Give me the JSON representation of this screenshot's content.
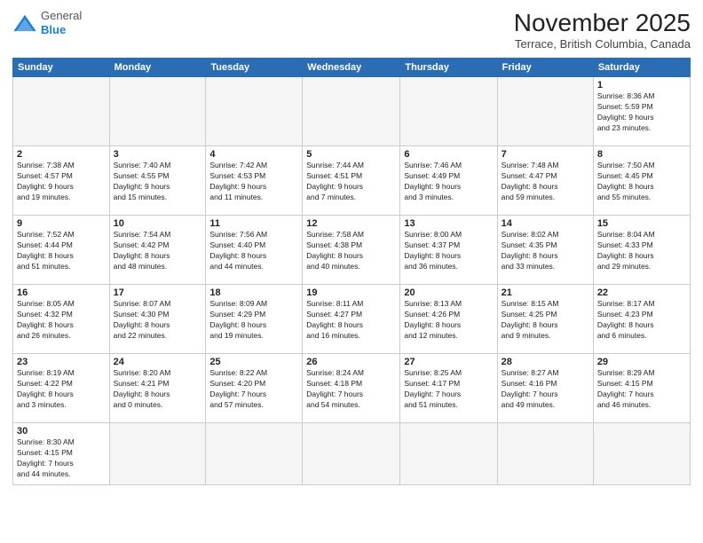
{
  "header": {
    "logo_general": "General",
    "logo_blue": "Blue",
    "month_title": "November 2025",
    "location": "Terrace, British Columbia, Canada"
  },
  "days_of_week": [
    "Sunday",
    "Monday",
    "Tuesday",
    "Wednesday",
    "Thursday",
    "Friday",
    "Saturday"
  ],
  "weeks": [
    [
      {
        "day": "",
        "empty": true
      },
      {
        "day": "",
        "empty": true
      },
      {
        "day": "",
        "empty": true
      },
      {
        "day": "",
        "empty": true
      },
      {
        "day": "",
        "empty": true
      },
      {
        "day": "",
        "empty": true
      },
      {
        "day": "1",
        "info": "Sunrise: 8:36 AM\nSunset: 5:59 PM\nDaylight: 9 hours\nand 23 minutes."
      }
    ],
    [
      {
        "day": "2",
        "info": "Sunrise: 7:38 AM\nSunset: 4:57 PM\nDaylight: 9 hours\nand 19 minutes."
      },
      {
        "day": "3",
        "info": "Sunrise: 7:40 AM\nSunset: 4:55 PM\nDaylight: 9 hours\nand 15 minutes."
      },
      {
        "day": "4",
        "info": "Sunrise: 7:42 AM\nSunset: 4:53 PM\nDaylight: 9 hours\nand 11 minutes."
      },
      {
        "day": "5",
        "info": "Sunrise: 7:44 AM\nSunset: 4:51 PM\nDaylight: 9 hours\nand 7 minutes."
      },
      {
        "day": "6",
        "info": "Sunrise: 7:46 AM\nSunset: 4:49 PM\nDaylight: 9 hours\nand 3 minutes."
      },
      {
        "day": "7",
        "info": "Sunrise: 7:48 AM\nSunset: 4:47 PM\nDaylight: 8 hours\nand 59 minutes."
      },
      {
        "day": "8",
        "info": "Sunrise: 7:50 AM\nSunset: 4:45 PM\nDaylight: 8 hours\nand 55 minutes."
      }
    ],
    [
      {
        "day": "9",
        "info": "Sunrise: 7:52 AM\nSunset: 4:44 PM\nDaylight: 8 hours\nand 51 minutes."
      },
      {
        "day": "10",
        "info": "Sunrise: 7:54 AM\nSunset: 4:42 PM\nDaylight: 8 hours\nand 48 minutes."
      },
      {
        "day": "11",
        "info": "Sunrise: 7:56 AM\nSunset: 4:40 PM\nDaylight: 8 hours\nand 44 minutes."
      },
      {
        "day": "12",
        "info": "Sunrise: 7:58 AM\nSunset: 4:38 PM\nDaylight: 8 hours\nand 40 minutes."
      },
      {
        "day": "13",
        "info": "Sunrise: 8:00 AM\nSunset: 4:37 PM\nDaylight: 8 hours\nand 36 minutes."
      },
      {
        "day": "14",
        "info": "Sunrise: 8:02 AM\nSunset: 4:35 PM\nDaylight: 8 hours\nand 33 minutes."
      },
      {
        "day": "15",
        "info": "Sunrise: 8:04 AM\nSunset: 4:33 PM\nDaylight: 8 hours\nand 29 minutes."
      }
    ],
    [
      {
        "day": "16",
        "info": "Sunrise: 8:05 AM\nSunset: 4:32 PM\nDaylight: 8 hours\nand 26 minutes."
      },
      {
        "day": "17",
        "info": "Sunrise: 8:07 AM\nSunset: 4:30 PM\nDaylight: 8 hours\nand 22 minutes."
      },
      {
        "day": "18",
        "info": "Sunrise: 8:09 AM\nSunset: 4:29 PM\nDaylight: 8 hours\nand 19 minutes."
      },
      {
        "day": "19",
        "info": "Sunrise: 8:11 AM\nSunset: 4:27 PM\nDaylight: 8 hours\nand 16 minutes."
      },
      {
        "day": "20",
        "info": "Sunrise: 8:13 AM\nSunset: 4:26 PM\nDaylight: 8 hours\nand 12 minutes."
      },
      {
        "day": "21",
        "info": "Sunrise: 8:15 AM\nSunset: 4:25 PM\nDaylight: 8 hours\nand 9 minutes."
      },
      {
        "day": "22",
        "info": "Sunrise: 8:17 AM\nSunset: 4:23 PM\nDaylight: 8 hours\nand 6 minutes."
      }
    ],
    [
      {
        "day": "23",
        "info": "Sunrise: 8:19 AM\nSunset: 4:22 PM\nDaylight: 8 hours\nand 3 minutes."
      },
      {
        "day": "24",
        "info": "Sunrise: 8:20 AM\nSunset: 4:21 PM\nDaylight: 8 hours\nand 0 minutes."
      },
      {
        "day": "25",
        "info": "Sunrise: 8:22 AM\nSunset: 4:20 PM\nDaylight: 7 hours\nand 57 minutes."
      },
      {
        "day": "26",
        "info": "Sunrise: 8:24 AM\nSunset: 4:18 PM\nDaylight: 7 hours\nand 54 minutes."
      },
      {
        "day": "27",
        "info": "Sunrise: 8:25 AM\nSunset: 4:17 PM\nDaylight: 7 hours\nand 51 minutes."
      },
      {
        "day": "28",
        "info": "Sunrise: 8:27 AM\nSunset: 4:16 PM\nDaylight: 7 hours\nand 49 minutes."
      },
      {
        "day": "29",
        "info": "Sunrise: 8:29 AM\nSunset: 4:15 PM\nDaylight: 7 hours\nand 46 minutes."
      }
    ],
    [
      {
        "day": "30",
        "info": "Sunrise: 8:30 AM\nSunset: 4:15 PM\nDaylight: 7 hours\nand 44 minutes.",
        "last": true
      },
      {
        "day": "",
        "empty": true,
        "last": true
      },
      {
        "day": "",
        "empty": true,
        "last": true
      },
      {
        "day": "",
        "empty": true,
        "last": true
      },
      {
        "day": "",
        "empty": true,
        "last": true
      },
      {
        "day": "",
        "empty": true,
        "last": true
      },
      {
        "day": "",
        "empty": true,
        "last": true
      }
    ]
  ]
}
